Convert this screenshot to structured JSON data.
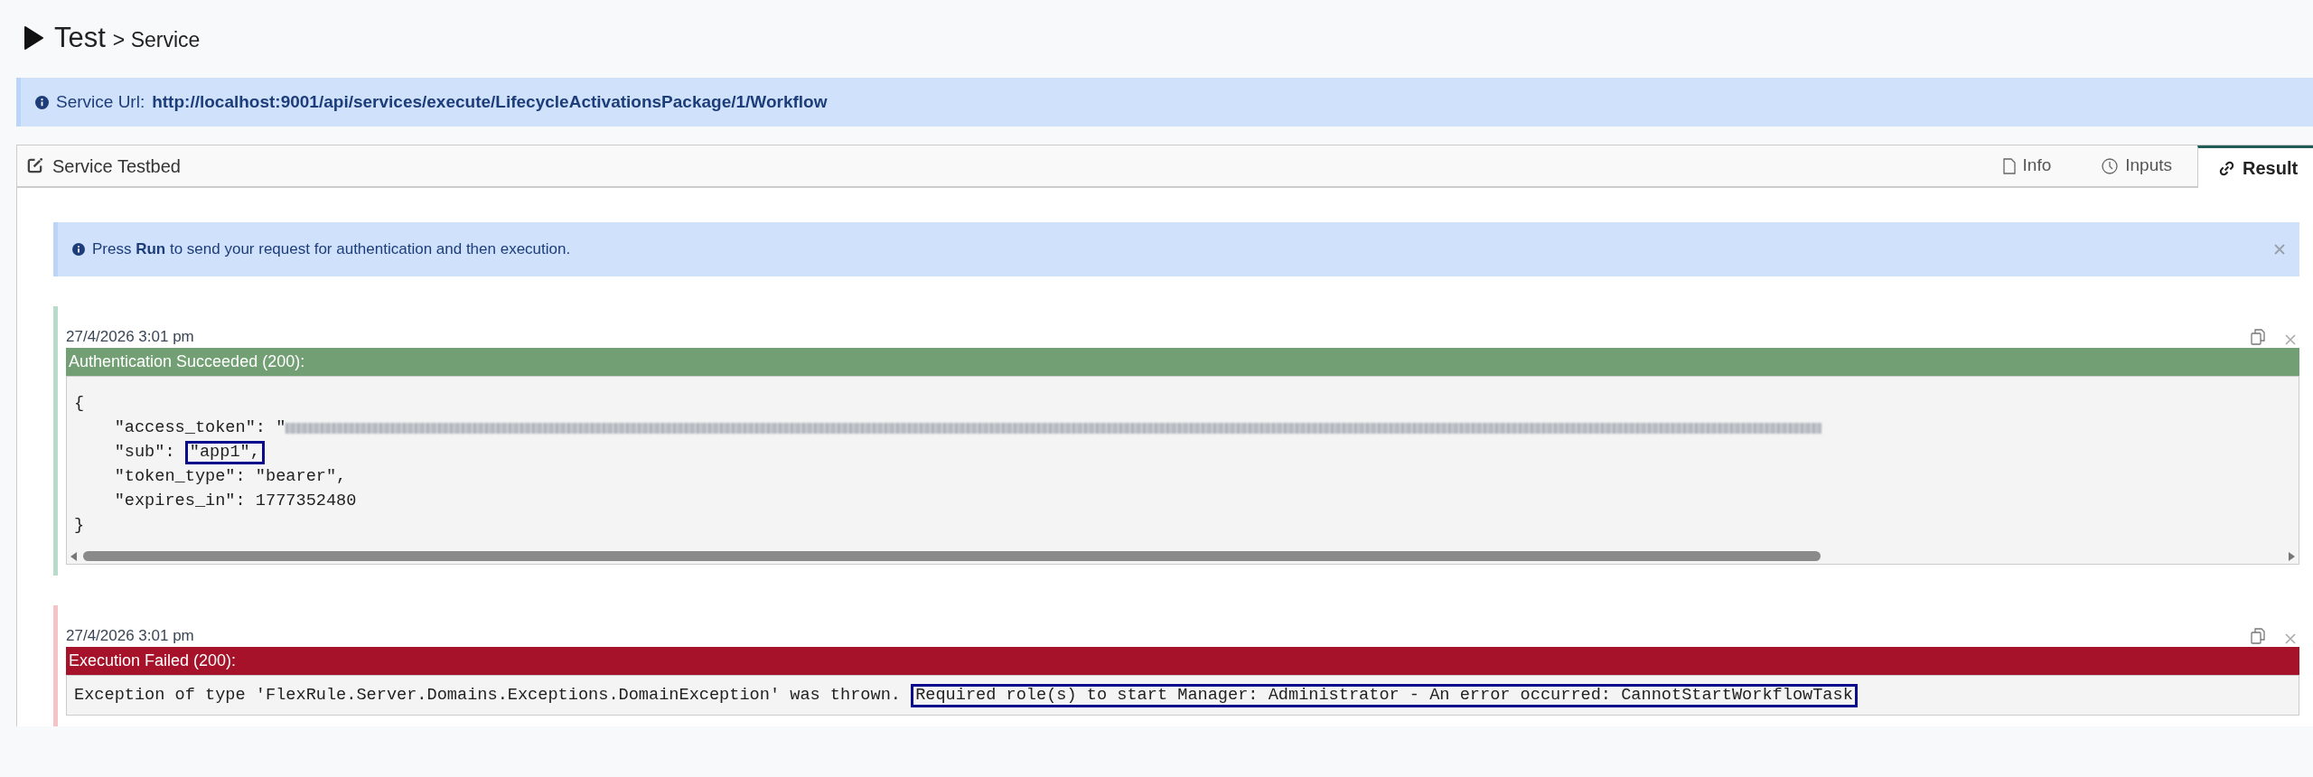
{
  "page_title": {
    "main": "Test",
    "sub": "> Service"
  },
  "service_url": {
    "label": "Service Url:",
    "url": "http://localhost:9001/api/services/execute/LifecycleActivationsPackage/1/Workflow"
  },
  "panel": {
    "title": "Service Testbed",
    "tabs": [
      {
        "label": "Info",
        "kind": "info",
        "selected": false
      },
      {
        "label": "Inputs",
        "kind": "inputs",
        "selected": false
      },
      {
        "label": "Result",
        "kind": "results",
        "selected": true
      }
    ]
  },
  "alert": {
    "text": "Press **Run** to send your request for authentication and then execution."
  },
  "results": [
    {
      "kind": "success",
      "time": "27/4/2026 3:01 pm",
      "header": "Authentication Succeeded (200):",
      "scrollable": true,
      "lines": [
        [
          {
            "kind": "text",
            "text": "{"
          }
        ],
        [
          {
            "kind": "text",
            "text": "    \"access_token\": \""
          },
          {
            "kind": "redacted"
          }
        ],
        [
          {
            "kind": "text",
            "text": "    \"sub\": "
          },
          {
            "kind": "highlight",
            "text": "\"app1\","
          }
        ],
        [
          {
            "kind": "text",
            "text": "    \"token_type\": \"bearer\","
          }
        ],
        [
          {
            "kind": "text",
            "text": "    \"expires_in\": 1777352480"
          }
        ],
        [
          {
            "kind": "text",
            "text": "}"
          }
        ]
      ]
    },
    {
      "kind": "error",
      "time": "27/4/2026 3:01 pm",
      "header": "Execution Failed (200):",
      "scrollable": false,
      "lines": [
        [
          {
            "kind": "text",
            "text": "Exception of type 'FlexRule.Server.Domains.Exceptions.DomainException' was thrown. "
          },
          {
            "kind": "highlight",
            "text": "Required role(s) to start Manager: Administrator - An error occurred: CannotStartWorkflowTask"
          }
        ]
      ]
    }
  ]
}
